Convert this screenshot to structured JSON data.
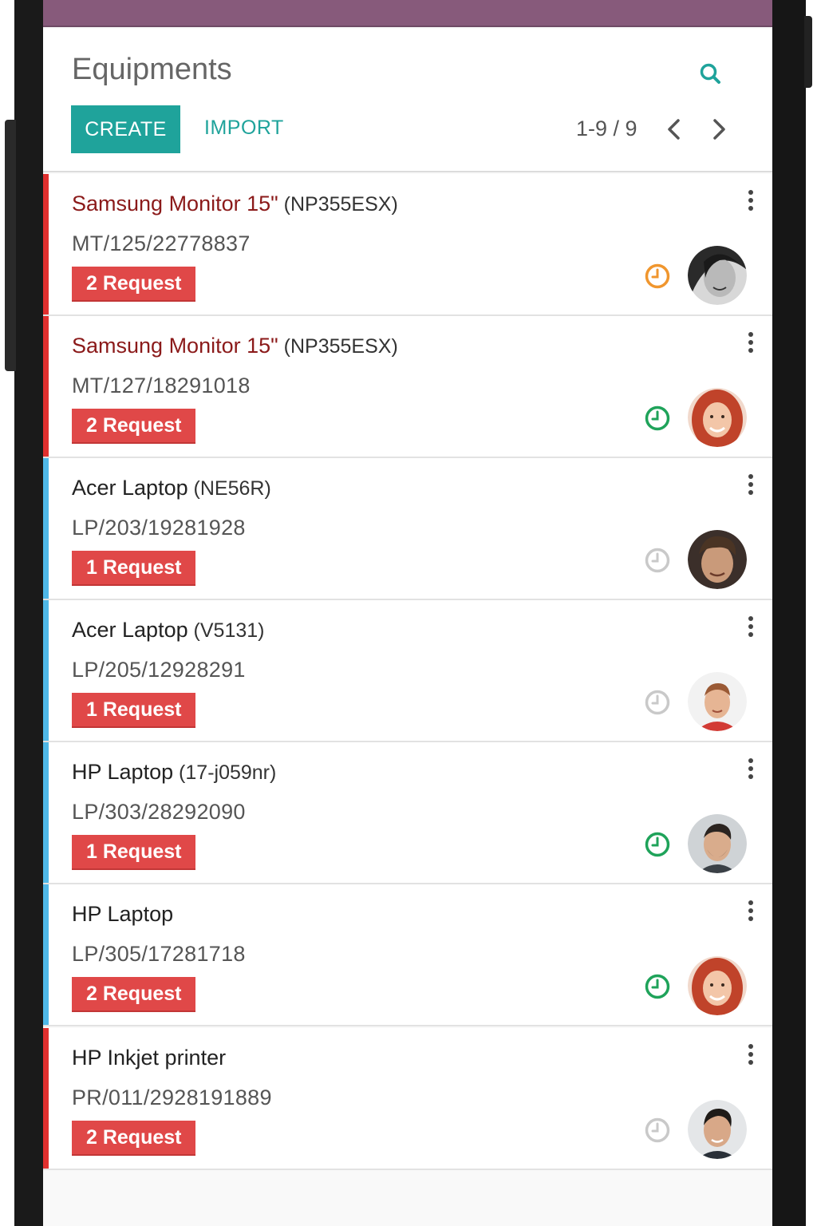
{
  "header": {
    "title": "Equipments",
    "create_label": "CREATE",
    "import_label": "IMPORT",
    "pager": "1-9 / 9"
  },
  "colors": {
    "brand": "#875a7b",
    "accent": "#1fa39b",
    "danger": "#e04848",
    "stripe_red": "#e0302f",
    "stripe_blue": "#4fb8e8"
  },
  "equipments": [
    {
      "name": "Samsung Monitor 15\"",
      "model": "(NP355ESX)",
      "ref": "MT/125/22778837",
      "requests": "2 Request",
      "stripe": "red",
      "name_color": "#8b1a1a",
      "name_weight": "normal",
      "clock_state": "orange",
      "avatar": "woman-bw"
    },
    {
      "name": "Samsung Monitor 15\"",
      "model": "(NP355ESX)",
      "ref": "MT/127/18291018",
      "requests": "2 Request",
      "stripe": "red",
      "name_color": "#8b1a1a",
      "name_weight": "normal",
      "clock_state": "green",
      "avatar": "woman-red-hair"
    },
    {
      "name": "Acer Laptop",
      "model": "(NE56R)",
      "ref": "LP/203/19281928",
      "requests": "1 Request",
      "stripe": "blue",
      "name_color": "#222222",
      "name_weight": "normal",
      "clock_state": "grey",
      "avatar": "man-curly"
    },
    {
      "name": "Acer Laptop",
      "model": "(V5131)",
      "ref": "LP/205/12928291",
      "requests": "1 Request",
      "stripe": "blue",
      "name_color": "#222222",
      "name_weight": "normal",
      "clock_state": "grey",
      "avatar": "man-red-shirt"
    },
    {
      "name": "HP Laptop",
      "model": "(17-j059nr)",
      "ref": "LP/303/28292090",
      "requests": "1 Request",
      "stripe": "blue",
      "name_color": "#222222",
      "name_weight": "normal",
      "clock_state": "green",
      "avatar": "man-beard"
    },
    {
      "name": "HP Laptop",
      "model": "",
      "ref": "LP/305/17281718",
      "requests": "2 Request",
      "stripe": "blue",
      "name_color": "#222222",
      "name_weight": "normal",
      "clock_state": "green",
      "avatar": "woman-red-hair"
    },
    {
      "name": "HP Inkjet printer",
      "model": "",
      "ref": "PR/011/2928191889",
      "requests": "2 Request",
      "stripe": "red",
      "name_color": "#222222",
      "name_weight": "normal",
      "clock_state": "grey",
      "avatar": "man-dark-hair"
    }
  ]
}
